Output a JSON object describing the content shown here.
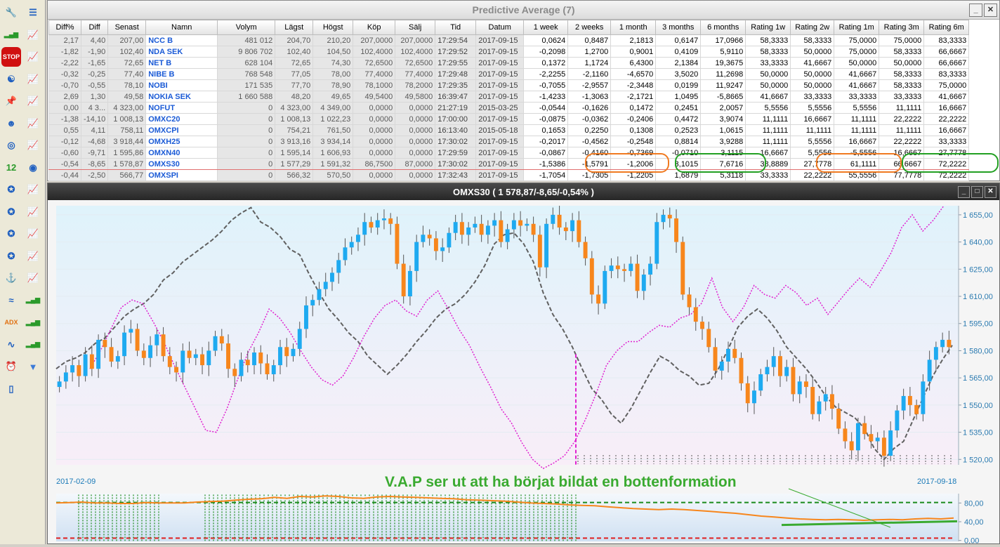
{
  "window_title": "Predictive Average (7)",
  "chart_window_title": "OMXS30 ( 1 578,87/-8,65/-0,54% )",
  "annotation_text": "V.A.P ser ut att ha börjat bildat en bottenformation",
  "date_start": "2017-02-09",
  "date_end": "2017-09-18",
  "toolbar_icons": [
    "wrench-icon",
    "document-list-icon",
    "bar-chart-icon",
    "chart-icon",
    "stop-icon",
    "chart-v-icon",
    "yin-yang-icon",
    "chart-1-icon",
    "pin-icon",
    "chart-2-icon",
    "avatar-icon",
    "chart-b-icon",
    "swirl-icon",
    "chart-f-icon",
    "calendar-icon",
    "world-icon",
    "compass-icon",
    "chart-m-icon",
    "compass-r-icon",
    "chart-r-icon",
    "compass-w-icon",
    "chart-q-icon",
    "compass-s-icon",
    "chart-s-icon",
    "anchor-icon",
    "chart-d-icon",
    "trend-lines-icon",
    "bars-icon",
    "adx-icon",
    "bars-alt-icon",
    "waveform-icon",
    "bars-green-icon",
    "alarm-clock-icon",
    "filter-icon",
    "blank-document-icon"
  ],
  "columns": [
    "Diff%",
    "Diff",
    "Senast",
    "Namn",
    "Volym",
    "Lägst",
    "Högst",
    "Köp",
    "Sälj",
    "Tid",
    "Datum",
    "1 week",
    "2 weeks",
    "1 month",
    "3 months",
    "6 months",
    "Rating 1w",
    "Rating 2w",
    "Rating 1m",
    "Rating 3m",
    "Rating 6m"
  ],
  "rows": [
    [
      "2,17",
      "4,40",
      "207,00",
      "NCC B",
      "481 012",
      "204,70",
      "210,20",
      "207,0000",
      "207,0000",
      "17:29:54",
      "2017-09-15",
      "0,0624",
      "0,8487",
      "2,1813",
      "0,6147",
      "17,0966",
      "58,3333",
      "58,3333",
      "75,0000",
      "75,0000",
      "83,3333"
    ],
    [
      "-1,82",
      "-1,90",
      "102,40",
      "NDA SEK",
      "9 806 702",
      "102,40",
      "104,50",
      "102,4000",
      "102,4000",
      "17:29:52",
      "2017-09-15",
      "-0,2098",
      "1,2700",
      "0,9001",
      "0,4109",
      "5,9110",
      "58,3333",
      "50,0000",
      "75,0000",
      "58,3333",
      "66,6667"
    ],
    [
      "-2,22",
      "-1,65",
      "72,65",
      "NET B",
      "628 104",
      "72,65",
      "74,30",
      "72,6500",
      "72,6500",
      "17:29:55",
      "2017-09-15",
      "0,1372",
      "1,1724",
      "6,4300",
      "2,1384",
      "19,3675",
      "33,3333",
      "41,6667",
      "50,0000",
      "50,0000",
      "66,6667"
    ],
    [
      "-0,32",
      "-0,25",
      "77,40",
      "NIBE B",
      "768 548",
      "77,05",
      "78,00",
      "77,4000",
      "77,4000",
      "17:29:48",
      "2017-09-15",
      "-2,2255",
      "-2,1160",
      "-4,6570",
      "3,5020",
      "11,2698",
      "50,0000",
      "50,0000",
      "41,6667",
      "58,3333",
      "83,3333"
    ],
    [
      "-0,70",
      "-0,55",
      "78,10",
      "NOBI",
      "171 535",
      "77,70",
      "78,90",
      "78,1000",
      "78,2000",
      "17:29:35",
      "2017-09-15",
      "-0,7055",
      "-2,9557",
      "-2,3448",
      "0,0199",
      "11,9247",
      "50,0000",
      "50,0000",
      "41,6667",
      "58,3333",
      "75,0000"
    ],
    [
      "2,69",
      "1,30",
      "49,58",
      "NOKIA SEK",
      "1 660 588",
      "48,20",
      "49,65",
      "49,5400",
      "49,5800",
      "16:39:47",
      "2017-09-15",
      "-1,4233",
      "-1,3063",
      "-2,1721",
      "1,0495",
      "-5,8665",
      "41,6667",
      "33,3333",
      "33,3333",
      "33,3333",
      "41,6667"
    ],
    [
      "0,00",
      "4 3...",
      "4 323,00",
      "NOFUT",
      "0",
      "4 323,00",
      "4 349,00",
      "0,0000",
      "0,0000",
      "21:27:19",
      "2015-03-25",
      "-0,0544",
      "-0,1626",
      "0,1472",
      "0,2451",
      "2,0057",
      "5,5556",
      "5,5556",
      "5,5556",
      "11,1111",
      "16,6667"
    ],
    [
      "-1,38",
      "-14,10",
      "1 008,13",
      "OMXC20",
      "0",
      "1 008,13",
      "1 022,23",
      "0,0000",
      "0,0000",
      "17:00:00",
      "2017-09-15",
      "-0,0875",
      "-0,0362",
      "-0,2406",
      "0,4472",
      "3,9074",
      "11,1111",
      "16,6667",
      "11,1111",
      "22,2222",
      "22,2222"
    ],
    [
      "0,55",
      "4,11",
      "758,11",
      "OMXCPI",
      "0",
      "754,21",
      "761,50",
      "0,0000",
      "0,0000",
      "16:13:40",
      "2015-05-18",
      "0,1653",
      "0,2250",
      "0,1308",
      "0,2523",
      "1,0615",
      "11,1111",
      "11,1111",
      "11,1111",
      "11,1111",
      "16,6667"
    ],
    [
      "-0,12",
      "-4,68",
      "3 918,44",
      "OMXH25",
      "0",
      "3 913,16",
      "3 934,14",
      "0,0000",
      "0,0000",
      "17:30:02",
      "2017-09-15",
      "-0,2017",
      "-0,4562",
      "-0,2548",
      "0,8814",
      "3,9288",
      "11,1111",
      "5,5556",
      "16,6667",
      "22,2222",
      "33,3333"
    ],
    [
      "-0,60",
      "-9,71",
      "1 595,86",
      "OMXN40",
      "0",
      "1 595,14",
      "1 606,93",
      "0,0000",
      "0,0000",
      "17:29:59",
      "2017-09-15",
      "-0,0867",
      "-0,4160",
      "-0,7369",
      "-0,0710",
      "3,1115",
      "16,6667",
      "5,5556",
      "-5,5556",
      "16,6667",
      "27,7778"
    ],
    [
      "-0,54",
      "-8,65",
      "1 578,87",
      "OMXS30",
      "0",
      "1 577,29",
      "1 591,32",
      "86,7500",
      "87,0000",
      "17:30:02",
      "2017-09-15",
      "-1,5386",
      "-1,5791",
      "-1,2006",
      "3,1015",
      "7,6716",
      "38,8889",
      "27,7778",
      "61,1111",
      "66,6667",
      "72,2222"
    ],
    [
      "-0,44",
      "-2,50",
      "566,77",
      "OMXSPI",
      "0",
      "566,32",
      "570,50",
      "0,0000",
      "0,0000",
      "17:32:43",
      "2017-09-15",
      "-1,7054",
      "-1,7305",
      "-1,2205",
      "1,6879",
      "5,3118",
      "33,3333",
      "22,2222",
      "55,5556",
      "77,7778",
      "72,2222"
    ]
  ],
  "price_axis_ticks": [
    "1 655,00",
    "1 640,00",
    "1 625,00",
    "1 610,00",
    "1 595,00",
    "1 580,00",
    "1 565,00",
    "1 550,00",
    "1 535,00",
    "1 520,00"
  ],
  "indicator_axis_ticks": [
    "80,00",
    "40,00",
    "0,00"
  ],
  "colors": {
    "up": "#1eaaf0",
    "down": "#f7861c",
    "magenta": "#e020d0",
    "dashed": "#606060",
    "green": "#2e9e2e",
    "orange_box": "#f07a20",
    "green_box": "#22a022"
  }
}
